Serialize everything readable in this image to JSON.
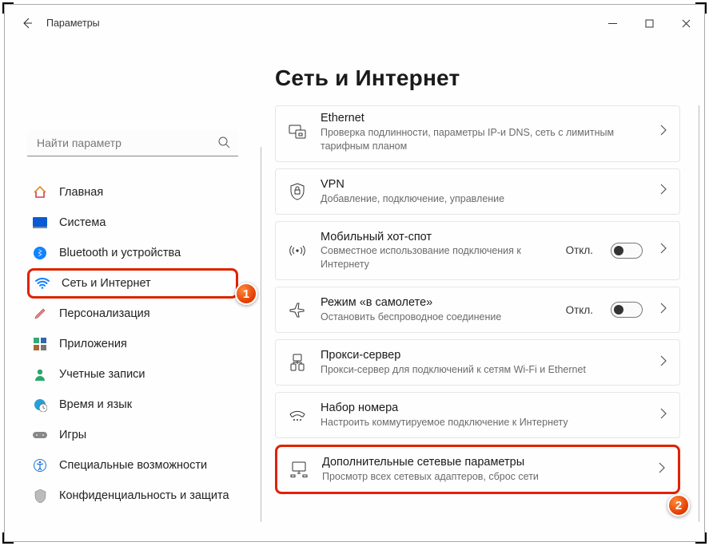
{
  "window": {
    "title": "Параметры"
  },
  "search": {
    "placeholder": "Найти параметр"
  },
  "nav": [
    {
      "id": "home",
      "label": "Главная"
    },
    {
      "id": "system",
      "label": "Система"
    },
    {
      "id": "bluetooth",
      "label": "Bluetooth и устройства"
    },
    {
      "id": "network",
      "label": "Сеть и Интернет"
    },
    {
      "id": "personal",
      "label": "Персонализация"
    },
    {
      "id": "apps",
      "label": "Приложения"
    },
    {
      "id": "accounts",
      "label": "Учетные записи"
    },
    {
      "id": "time",
      "label": "Время и язык"
    },
    {
      "id": "gaming",
      "label": "Игры"
    },
    {
      "id": "access",
      "label": "Специальные возможности"
    },
    {
      "id": "privacy",
      "label": "Конфиденциальность и защита"
    }
  ],
  "page": {
    "title": "Сеть и Интернет"
  },
  "callouts": {
    "one": "1",
    "two": "2"
  },
  "cards": {
    "ethernet": {
      "title": "Ethernet",
      "sub": "Проверка подлинности, параметры IP-и DNS, сеть с лимитным тарифным планом"
    },
    "vpn": {
      "title": "VPN",
      "sub": "Добавление, подключение, управление"
    },
    "hotspot": {
      "title": "Мобильный хот-спот",
      "sub": "Совместное использование подключения к Интернету",
      "state": "Откл."
    },
    "airplane": {
      "title": "Режим «в самолете»",
      "sub": "Остановить беспроводное соединение",
      "state": "Откл."
    },
    "proxy": {
      "title": "Прокси-сервер",
      "sub": "Прокси-сервер для подключений к сетям Wi-Fi и Ethernet"
    },
    "dialup": {
      "title": "Набор номера",
      "sub": "Настроить коммутируемое подключение к Интернету"
    },
    "advanced": {
      "title": "Дополнительные сетевые параметры",
      "sub": "Просмотр всех сетевых адаптеров, сброс сети"
    }
  }
}
